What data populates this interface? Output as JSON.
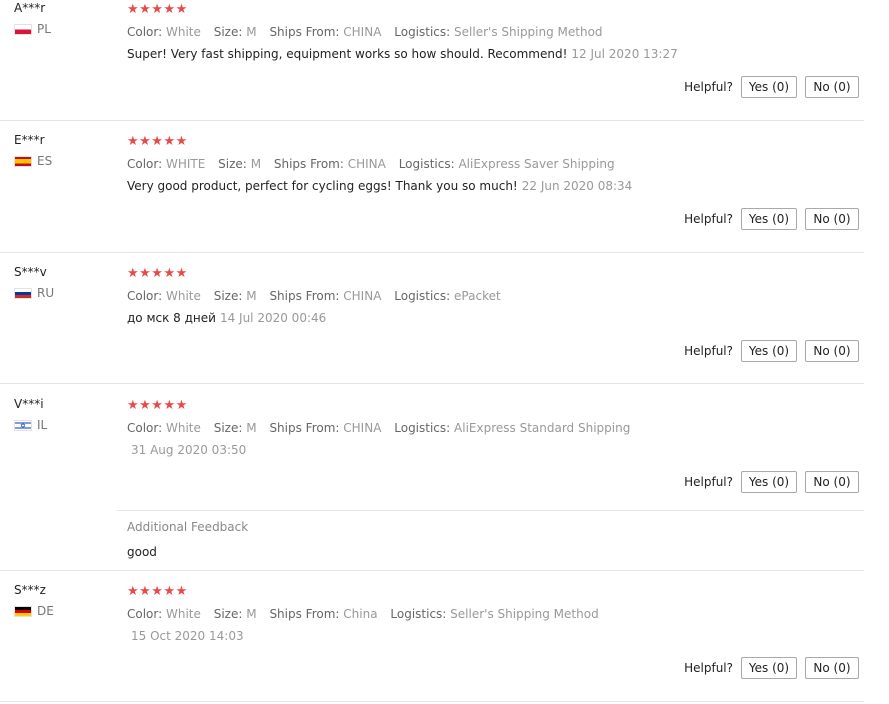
{
  "labels": {
    "color": "Color:",
    "size": "Size:",
    "ships_from": "Ships From:",
    "logistics": "Logistics:",
    "helpful": "Helpful?",
    "yes": "Yes (0)",
    "no": "No (0)",
    "additional_feedback": "Additional Feedback"
  },
  "rating_stars": "★★★★★",
  "reviews": [
    {
      "user": "A***r",
      "country": "PL",
      "flag": "pl-flag-icon",
      "color": "White",
      "size": "M",
      "ships_from": "CHINA",
      "logistics": "Seller's Shipping Method",
      "text": "Super! Very fast shipping, equipment works so how should. Recommend!",
      "date": "12 Jul 2020 13:27"
    },
    {
      "user": "E***r",
      "country": "ES",
      "flag": "es-flag-icon",
      "color": "WHITE",
      "size": "M",
      "ships_from": "CHINA",
      "logistics": "AliExpress Saver Shipping",
      "text": "Very good product, perfect for cycling eggs! Thank you so much!",
      "date": "22 Jun 2020 08:34"
    },
    {
      "user": "S***v",
      "country": "RU",
      "flag": "ru-flag-icon",
      "color": "White",
      "size": "M",
      "ships_from": "CHINA",
      "logistics": "ePacket",
      "text": "до мск 8 дней",
      "date": "14 Jul 2020 00:46"
    },
    {
      "user": "V***i",
      "country": "IL",
      "flag": "il-flag-icon",
      "color": "White",
      "size": "M",
      "ships_from": "CHINA",
      "logistics": "AliExpress Standard Shipping",
      "text": "",
      "date": "31 Aug 2020 03:50",
      "additional_feedback": "good"
    },
    {
      "user": "S***z",
      "country": "DE",
      "flag": "de-flag-icon",
      "color": "White",
      "size": "M",
      "ships_from": "China",
      "logistics": "Seller's Shipping Method",
      "text": "",
      "date": "15 Oct 2020 14:03"
    }
  ]
}
